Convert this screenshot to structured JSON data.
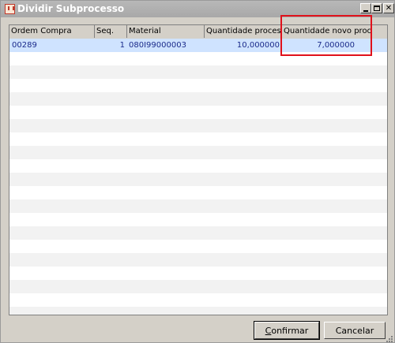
{
  "window": {
    "title": "Dividir Subprocesso"
  },
  "grid": {
    "columns": [
      "Ordem Compra",
      "Seq.",
      "Material",
      "Quantidade processo",
      "Quantidade novo processo"
    ],
    "rows": [
      {
        "ordem": "00289",
        "seq": "1",
        "material": "080I99000003",
        "qtd": "10,000000",
        "qtd_novo": "7,000000"
      }
    ]
  },
  "buttons": {
    "confirm_accel": "C",
    "confirm_rest": "onfirmar",
    "cancel": "Cancelar"
  },
  "colors": {
    "highlight": "#e0111b",
    "selected_row": "#cfe3ff",
    "titlebar": "#a8a8a8"
  }
}
